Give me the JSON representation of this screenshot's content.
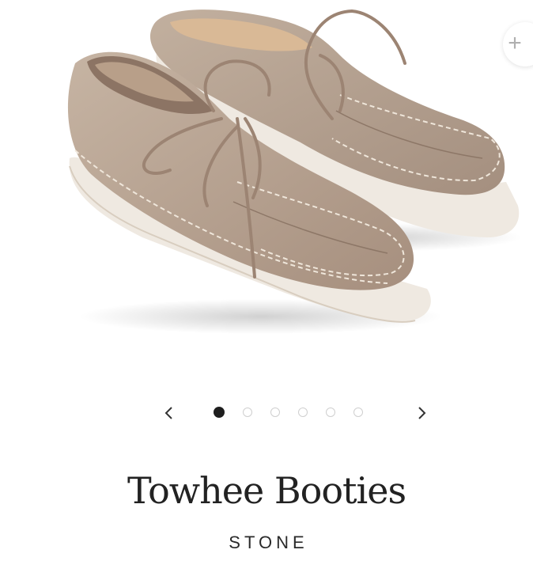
{
  "product": {
    "name": "Towhee Booties",
    "variant": "STONE",
    "image_alt": "tan suede lace-up moccasin booties with white sole",
    "colors": {
      "suede": "#b9a593",
      "suede_shadow": "#9c8676",
      "sole": "#efe9e1",
      "lace": "#9c8473"
    }
  },
  "gallery": {
    "zoom_icon": "plus-icon",
    "zoom_symbol": "+",
    "prev_icon": "chevron-left-icon",
    "next_icon": "chevron-right-icon",
    "total_images": 6,
    "active_index": 0
  }
}
